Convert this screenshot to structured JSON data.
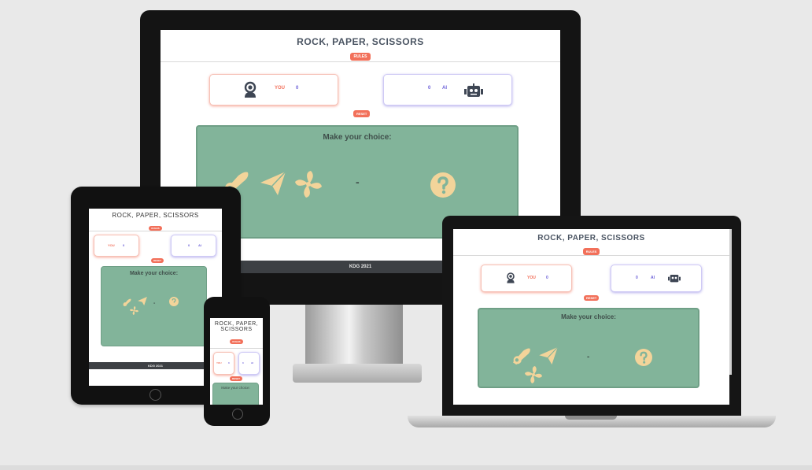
{
  "app": {
    "title": "ROCK, PAPER, SCISSORS",
    "title_line1": "ROCK, PAPER,",
    "title_line2": "SCISSORS",
    "header_button": "RULES",
    "player_label": "YOU",
    "player_score": "0",
    "ai_label": "AI",
    "ai_score": "0",
    "reset_button": "RESET",
    "prompt": "Make your choice:",
    "versus": "-",
    "footer": "KDG 2021"
  },
  "icons": [
    "user-astronaut-icon",
    "robot-icon",
    "rock-icon",
    "paper-icon",
    "scissors-icon",
    "question-icon"
  ],
  "colors": {
    "accent": "#f2705a",
    "ai": "#6b5fd8",
    "game_area": "#82b49a",
    "icon": "#f3d49a",
    "footer": "#3d4044"
  }
}
